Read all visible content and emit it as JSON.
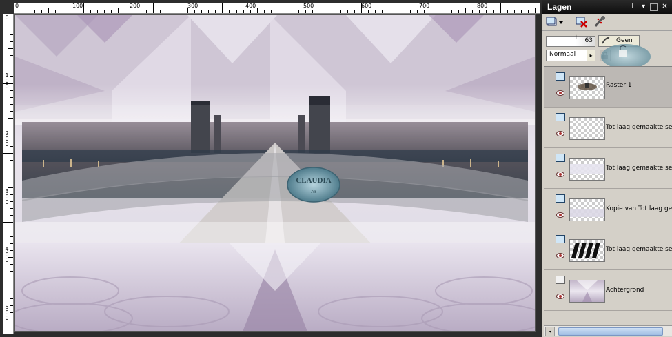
{
  "workspace": {
    "ruler_top_labels": [
      "0",
      "100",
      "200",
      "300",
      "400",
      "500",
      "600",
      "700",
      "800"
    ],
    "ruler_left_labels": [
      "0",
      "100",
      "200",
      "300",
      "400",
      "500"
    ],
    "watermark_text": "CLAUDIA",
    "watermark_subtext": "Alr"
  },
  "layers_panel": {
    "title": "Lagen",
    "opacity_value": "63",
    "mask_button_label": "Geen",
    "blend_mode": "Normaal",
    "layers": [
      {
        "name": "Raster 1",
        "selected": true,
        "thumb": "raster"
      },
      {
        "name": "Tot laag gemaakte sele",
        "selected": false,
        "thumb": "empty"
      },
      {
        "name": "Tot laag gemaakte sele",
        "selected": false,
        "thumb": "light"
      },
      {
        "name": "Kopie van Tot laag gen",
        "selected": false,
        "thumb": "light2"
      },
      {
        "name": "Tot laag gemaakte sele",
        "selected": false,
        "thumb": "stripes"
      },
      {
        "name": "Achtergrond",
        "selected": false,
        "thumb": "background"
      }
    ]
  },
  "colors": {
    "panel_bg": "#d4d0c8",
    "title_bg": "#1a1a1a",
    "selected_layer": "#bcb8b4",
    "canvas_tint": "#c8bdd0"
  }
}
